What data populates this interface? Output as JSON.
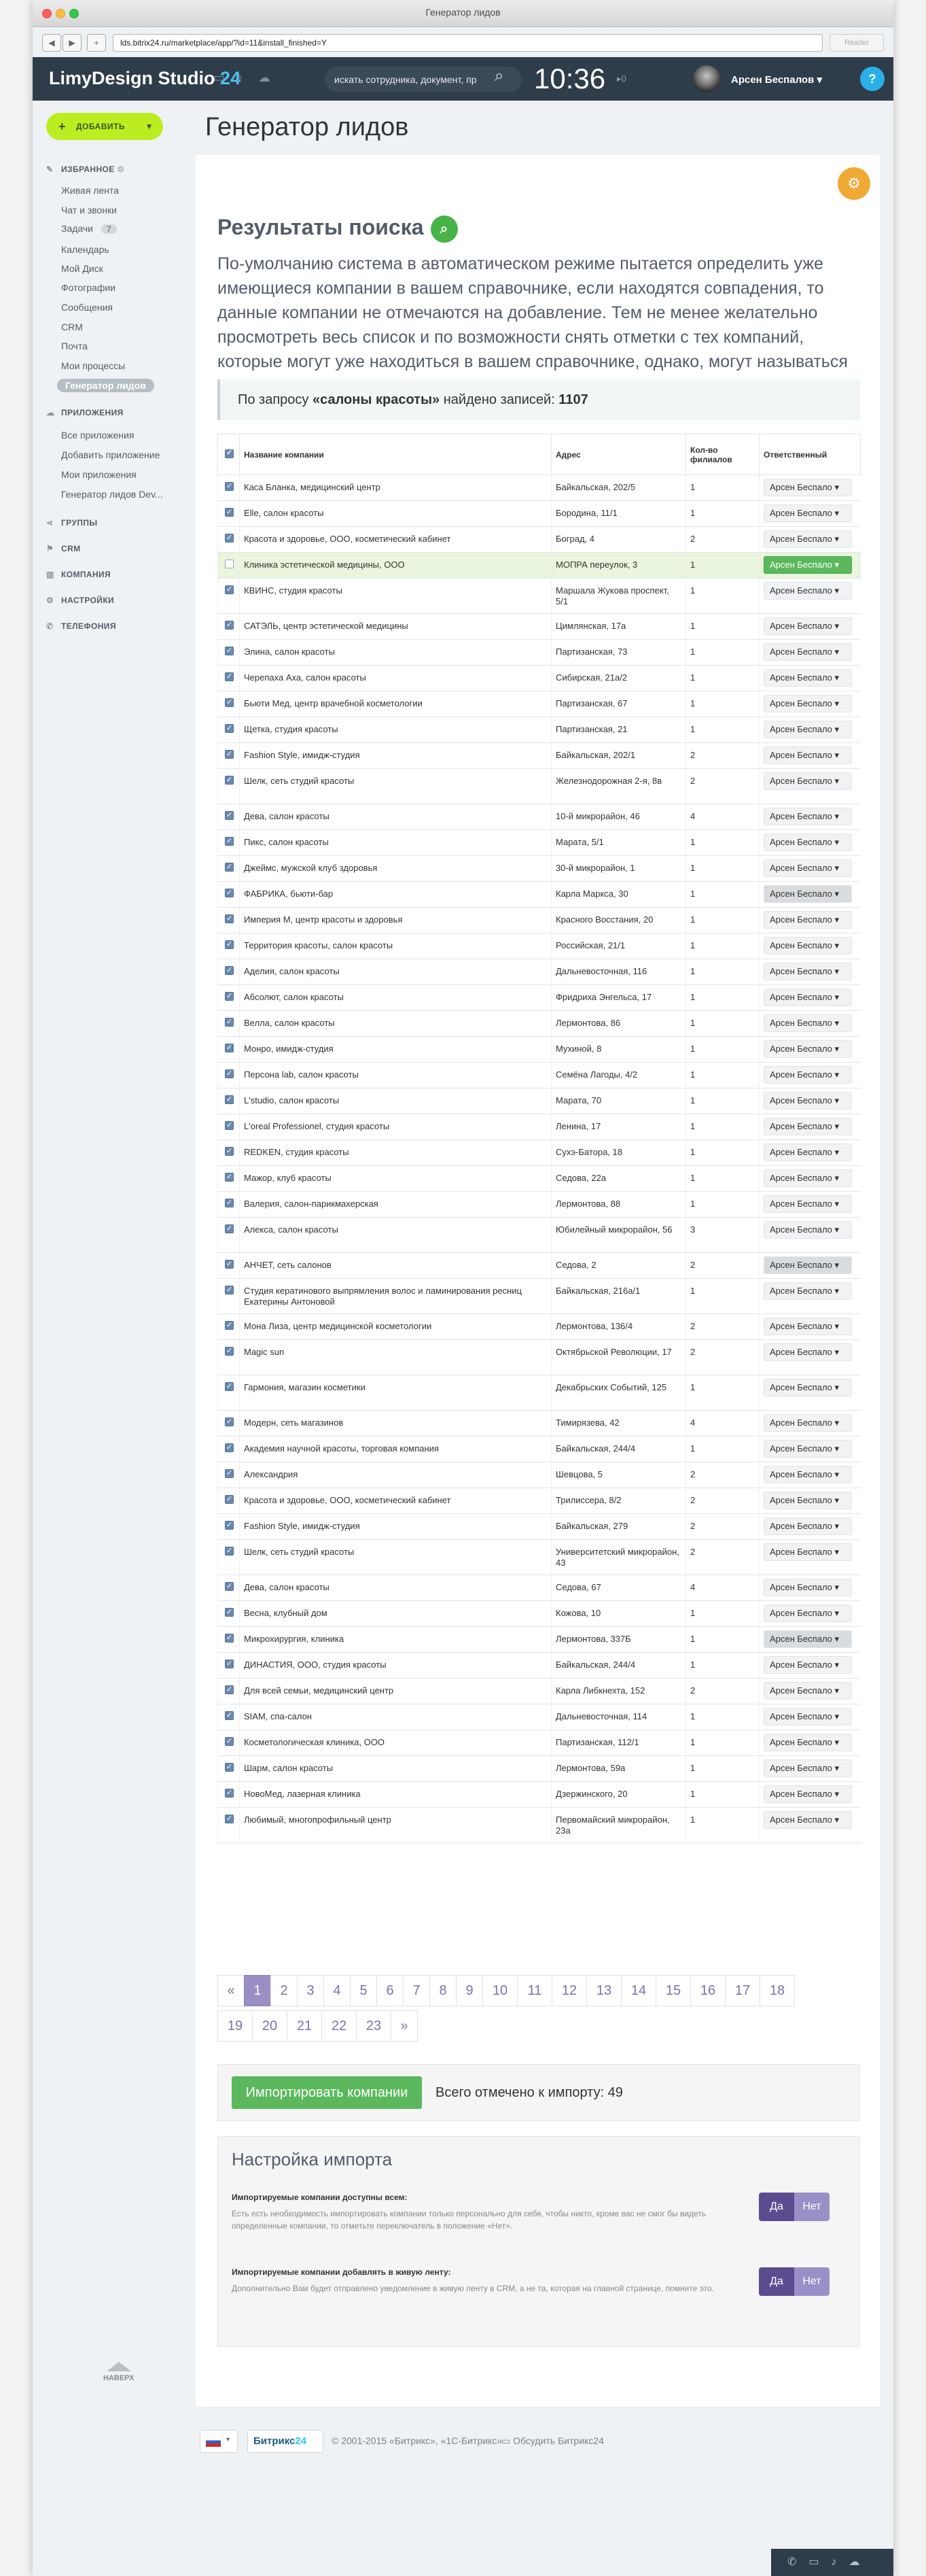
{
  "window": {
    "title": "Генератор лидов",
    "url": "lds.bitrix24.ru/marketplace/app/?id=11&install_finished=Y",
    "reader": "Reader"
  },
  "header": {
    "logo_main": "LimyDesign Studio",
    "logo_num": "24",
    "search_placeholder": "искать сотрудника, документ, пр",
    "clock": "10:36",
    "bell": "0",
    "user": "Арсен Беспалов",
    "help": "?"
  },
  "sidebar": {
    "add_label": "ДОБАВИТЬ",
    "favorites_title": "ИЗБРАННОЕ",
    "favorites": [
      "Живая лента",
      "Чат и звонки",
      "Задачи",
      "Календарь",
      "Мой Диск",
      "Фотографии",
      "Сообщения",
      "CRM",
      "Почта",
      "Мои процессы",
      "Генератор лидов"
    ],
    "tasks_badge": "7",
    "apps_title": "ПРИЛОЖЕНИЯ",
    "apps": [
      "Все приложения",
      "Добавить приложение",
      "Мои приложения",
      "Генератор лидов Dev..."
    ],
    "sections": [
      "ГРУППЫ",
      "CRM",
      "КОМПАНИЯ",
      "НАСТРОЙКИ",
      "ТЕЛЕФОНИЯ"
    ],
    "to_top": "НАВЕРХ"
  },
  "page_title": "Генератор лидов",
  "results": {
    "title": "Результаты поиска",
    "intro": "По-умолчанию система в автоматическом режиме пытается определить уже имеющиеся компании в вашем справочнике, если находятся совпадения, то данные компании не отмечаются на добавление. Тем не менее желательно просмотреть весь список и по возможности снять отметки с тех компаний, которые могут уже находиться в вашем справочнике, однако, могут называться по другому.",
    "query_prefix": "По запросу ",
    "query_term": "«салоны красоты»",
    "query_mid": " найдено записей: ",
    "query_count": "1107"
  },
  "table": {
    "headers": [
      "Название компании",
      "Адрес",
      "Кол-во филиалов",
      "Ответственный"
    ],
    "rows": [
      {
        "name": "Каса Бланка, медицинский центр",
        "addr": "Байкальская, 202/5",
        "f": "1",
        "c": true,
        "r": "n"
      },
      {
        "name": "Elle, салон красоты",
        "addr": "Бородина, 11/1",
        "f": "1",
        "c": true,
        "r": "n"
      },
      {
        "name": "Красота и здоровье, ООО, косметический кабинет",
        "addr": "Боград, 4",
        "f": "2",
        "c": true,
        "r": "n"
      },
      {
        "name": "Клиника эстетической медицины, ООО",
        "addr": "МОПРА переулок, 3",
        "f": "1",
        "c": false,
        "r": "g",
        "sel": true
      },
      {
        "name": "КВИНС, студия красоты",
        "addr": "Маршала Жукова проспект, 5/1",
        "f": "1",
        "c": true,
        "r": "n"
      },
      {
        "name": "САТЭЛЬ, центр эстетической медицины",
        "addr": "Цимлянская, 17а",
        "f": "1",
        "c": true,
        "r": "n"
      },
      {
        "name": "Элина, салон красоты",
        "addr": "Партизанская, 73",
        "f": "1",
        "c": true,
        "r": "n"
      },
      {
        "name": "Черепаха Аха, салон красоты",
        "addr": "Сибирская, 21а/2",
        "f": "1",
        "c": true,
        "r": "n"
      },
      {
        "name": "Бьюти Мед, центр врачебной косметологии",
        "addr": "Партизанская, 67",
        "f": "1",
        "c": true,
        "r": "n"
      },
      {
        "name": "Щетка, студия красоты",
        "addr": "Партизанская, 21",
        "f": "1",
        "c": true,
        "r": "n"
      },
      {
        "name": "Fashion Style, имидж-студия",
        "addr": "Байкальская, 202/1",
        "f": "2",
        "c": true,
        "r": "n"
      },
      {
        "name": "Шелк, сеть студий красоты",
        "addr": "Железнодорожная 2-я, 8в",
        "f": "2",
        "c": true,
        "r": "n"
      },
      {
        "name": "Дева, салон красоты",
        "addr": "10-й микрорайон, 46",
        "f": "4",
        "c": true,
        "r": "n"
      },
      {
        "name": "Пикс, салон красоты",
        "addr": "Марата, 5/1",
        "f": "1",
        "c": true,
        "r": "n"
      },
      {
        "name": "Джеймс, мужской клуб здоровья",
        "addr": "30-й микрорайон, 1",
        "f": "1",
        "c": true,
        "r": "n"
      },
      {
        "name": "ФАБРИКА, бьюти-бар",
        "addr": "Карла Маркса, 30",
        "f": "1",
        "c": true,
        "r": "d"
      },
      {
        "name": "Империя М, центр красоты и здоровья",
        "addr": "Красного Восстания, 20",
        "f": "1",
        "c": true,
        "r": "n"
      },
      {
        "name": "Территория красоты, салон красоты",
        "addr": "Российская, 21/1",
        "f": "1",
        "c": true,
        "r": "n"
      },
      {
        "name": "Аделия, салон красоты",
        "addr": "Дальневосточная, 116",
        "f": "1",
        "c": true,
        "r": "n"
      },
      {
        "name": "Абсолют, салон красоты",
        "addr": "Фридриха Энгельса, 17",
        "f": "1",
        "c": true,
        "r": "n"
      },
      {
        "name": "Велла, салон красоты",
        "addr": "Лермонтова, 86",
        "f": "1",
        "c": true,
        "r": "n"
      },
      {
        "name": "Монро, имидж-студия",
        "addr": "Мухиной, 8",
        "f": "1",
        "c": true,
        "r": "n"
      },
      {
        "name": "Персона lab, салон красоты",
        "addr": "Семёна Лагоды, 4/2",
        "f": "1",
        "c": true,
        "r": "n"
      },
      {
        "name": "L'studio, салон красоты",
        "addr": "Марата, 70",
        "f": "1",
        "c": true,
        "r": "n"
      },
      {
        "name": "L'oreal Professionel, студия красоты",
        "addr": "Ленина, 17",
        "f": "1",
        "c": true,
        "r": "n"
      },
      {
        "name": "REDKEN, студия красоты",
        "addr": "Сухэ-Батора, 18",
        "f": "1",
        "c": true,
        "r": "n"
      },
      {
        "name": "Мажор, клуб красоты",
        "addr": "Седова, 22а",
        "f": "1",
        "c": true,
        "r": "n"
      },
      {
        "name": "Валерия, салон-парикмахерская",
        "addr": "Лермонтова, 88",
        "f": "1",
        "c": true,
        "r": "n"
      },
      {
        "name": "Алекса, салон красоты",
        "addr": "Юбилейный микрорайон, 56",
        "f": "3",
        "c": true,
        "r": "n"
      },
      {
        "name": "АНЧЕТ, сеть салонов",
        "addr": "Седова, 2",
        "f": "2",
        "c": true,
        "r": "d"
      },
      {
        "name": "Студия кератинового выпрямления волос и ламинирования ресниц Екатерины Антоновой",
        "addr": "Байкальская, 216а/1",
        "f": "1",
        "c": true,
        "r": "n"
      },
      {
        "name": "Мона Лиза, центр медицинской косметологии",
        "addr": "Лермонтова, 136/4",
        "f": "2",
        "c": true,
        "r": "n"
      },
      {
        "name": "Magic sun",
        "addr": "Октябрьской Революции, 17",
        "f": "2",
        "c": true,
        "r": "n"
      },
      {
        "name": "Гармония, магазин косметики",
        "addr": "Декабрьских Событий, 125",
        "f": "1",
        "c": true,
        "r": "n"
      },
      {
        "name": "Модерн, сеть магазинов",
        "addr": "Тимирязева, 42",
        "f": "4",
        "c": true,
        "r": "n"
      },
      {
        "name": "Академия научной красоты, торговая компания",
        "addr": "Байкальская, 244/4",
        "f": "1",
        "c": true,
        "r": "n"
      },
      {
        "name": "Александрия",
        "addr": "Шевцова, 5",
        "f": "2",
        "c": true,
        "r": "n"
      },
      {
        "name": "Красота и здоровье, ООО, косметический кабинет",
        "addr": "Трилиссера, 8/2",
        "f": "2",
        "c": true,
        "r": "n"
      },
      {
        "name": "Fashion Style, имидж-студия",
        "addr": "Байкальская, 279",
        "f": "2",
        "c": true,
        "r": "n"
      },
      {
        "name": "Шелк, сеть студий красоты",
        "addr": "Университетский микрорайон, 43",
        "f": "2",
        "c": true,
        "r": "n"
      },
      {
        "name": "Дева, салон красоты",
        "addr": "Седова, 67",
        "f": "4",
        "c": true,
        "r": "n"
      },
      {
        "name": "Весна, клубный дом",
        "addr": "Кожова, 10",
        "f": "1",
        "c": true,
        "r": "n"
      },
      {
        "name": "Микрохирургия, клиника",
        "addr": "Лермонтова, 337Б",
        "f": "1",
        "c": true,
        "r": "d"
      },
      {
        "name": "ДИНАСТИЯ, ООО, студия красоты",
        "addr": "Байкальская, 244/4",
        "f": "1",
        "c": true,
        "r": "n"
      },
      {
        "name": "Для всей семьи, медицинский центр",
        "addr": "Карла Либкнехта, 152",
        "f": "2",
        "c": true,
        "r": "n"
      },
      {
        "name": "SIAM, спа-салон",
        "addr": "Дальневосточная, 114",
        "f": "1",
        "c": true,
        "r": "n"
      },
      {
        "name": "Косметологическая клиника, ООО",
        "addr": "Партизанская, 112/1",
        "f": "1",
        "c": true,
        "r": "n"
      },
      {
        "name": "Шарм, салон красоты",
        "addr": "Лермонтова, 59а",
        "f": "1",
        "c": true,
        "r": "n"
      },
      {
        "name": "НовоМед, лазерная клиника",
        "addr": "Дзержинского, 20",
        "f": "1",
        "c": true,
        "r": "n"
      },
      {
        "name": "Любимый, многопрофильный центр",
        "addr": "Первомайский микрорайон, 23а",
        "f": "1",
        "c": true,
        "r": "n"
      }
    ],
    "responsible": "Арсен Беспало"
  },
  "pager": {
    "row1": [
      "«",
      "1",
      "2",
      "3",
      "4",
      "5",
      "6",
      "7",
      "8",
      "9",
      "10",
      "11",
      "12",
      "13",
      "14",
      "15",
      "16",
      "17",
      "18"
    ],
    "row2": [
      "19",
      "20",
      "21",
      "22",
      "23",
      "»"
    ],
    "active": "1"
  },
  "import": {
    "button": "Импортировать компании",
    "count_text": "Всего отмечено к импорту: 49"
  },
  "settings": {
    "title": "Настройка импорта",
    "opt1_title": "Импортируемые компании доступны всем:",
    "opt1_desc": "Есть есть необходимость импортировать компании только персонально для себя, чтобы никто, кроме вас не смог бы видеть определенные компании, то отметьте переключатель в положение «Нет».",
    "opt2_title": "Импортируемые компании добавлять в живую ленту:",
    "opt2_desc": "Дополнительно Вам будет отправлено уведомление в живую ленту в CRM, а не та, которая на главной странице, помните это.",
    "yes": "Да",
    "no": "Нет"
  },
  "footer": {
    "flag_arrow": "▾",
    "brand": "Битрикс",
    "brand_num": "24",
    "copyright": "© 2001-2015 «Битрикс», «1С-Битрикс»",
    "discuss": "Обсудить Битрикс24"
  },
  "colors": {
    "accent_green": "#bbed21",
    "header_bg": "#2f3d4a",
    "pager_active": "#9a8ec2",
    "import_btn": "#5cb85c"
  }
}
